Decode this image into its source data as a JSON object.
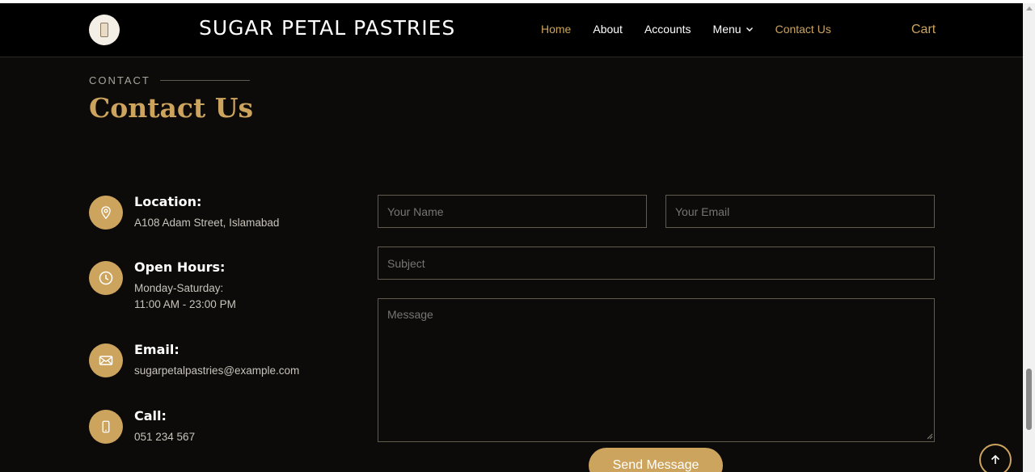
{
  "header": {
    "site_title": "SUGAR PETAL PASTRIES",
    "nav": [
      {
        "label": "Home",
        "active": true
      },
      {
        "label": "About"
      },
      {
        "label": "Accounts"
      },
      {
        "label": "Menu",
        "has_dropdown": true
      },
      {
        "label": "Contact Us",
        "active": true
      }
    ],
    "cart_label": "Cart"
  },
  "section": {
    "eyebrow": "CONTACT",
    "title": "Contact Us"
  },
  "contact_info": [
    {
      "icon": "map-pin-icon",
      "title": "Location:",
      "lines": [
        "A108 Adam Street, Islamabad"
      ]
    },
    {
      "icon": "clock-icon",
      "title": "Open Hours:",
      "lines": [
        "Monday-Saturday:",
        "11:00 AM - 23:00 PM"
      ]
    },
    {
      "icon": "envelope-icon",
      "title": "Email:",
      "lines": [
        "sugarpetalpastries@example.com"
      ]
    },
    {
      "icon": "phone-icon",
      "title": "Call:",
      "lines": [
        "051 234 567"
      ]
    }
  ],
  "form": {
    "name_placeholder": "Your Name",
    "email_placeholder": "Your Email",
    "subject_placeholder": "Subject",
    "message_placeholder": "Message",
    "submit_label": "Send Message"
  },
  "colors": {
    "accent": "#cda45e",
    "background": "#0c0b09",
    "header_bg": "#000000"
  }
}
